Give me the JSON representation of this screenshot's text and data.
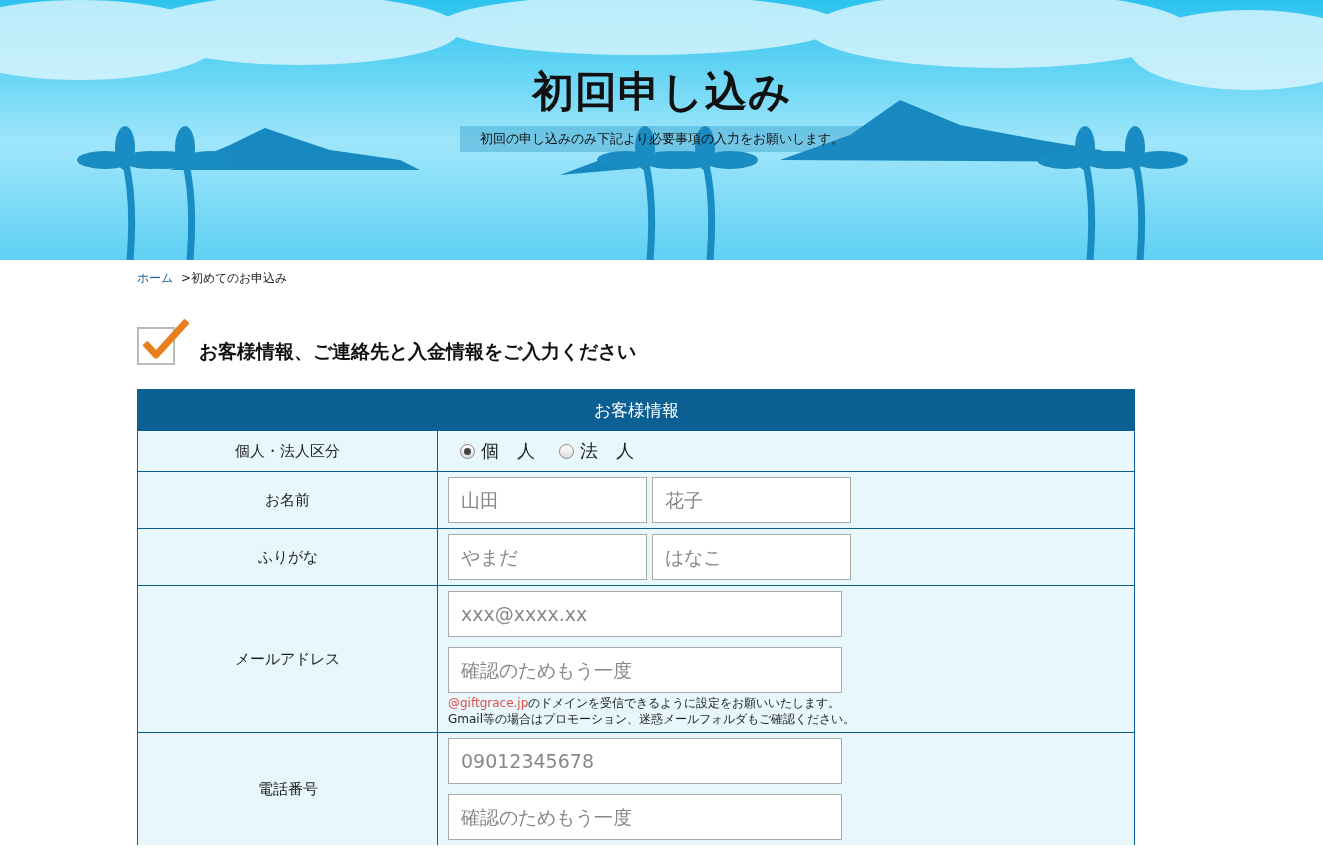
{
  "banner": {
    "title": "初回申し込み",
    "subtitle": "初回の申し込みのみ下記より必要事項の入力をお願いします。"
  },
  "breadcrumb": {
    "home": "ホーム",
    "current": ">初めてのお申込み"
  },
  "section": {
    "heading": "お客様情報、ご連絡先と入金情報をご入力ください",
    "checked": true
  },
  "form": {
    "title": "お客様情報",
    "rows": [
      {
        "kind": "radio",
        "label": "個人・法人区分",
        "options": [
          {
            "label": "個　人",
            "selected": true
          },
          {
            "label": "法　人",
            "selected": false
          }
        ]
      },
      {
        "kind": "pair",
        "label": "お名前",
        "fields": [
          {
            "placeholder": "山田"
          },
          {
            "placeholder": "花子"
          }
        ]
      },
      {
        "kind": "pair",
        "label": "ふりがな",
        "fields": [
          {
            "placeholder": "やまだ"
          },
          {
            "placeholder": "はなこ"
          }
        ]
      },
      {
        "kind": "stack",
        "label": "メールアドレス",
        "fields": [
          {
            "placeholder": "xxx@xxxx.xx"
          },
          {
            "placeholder": "確認のためもう一度"
          }
        ],
        "note": {
          "domain": "@giftgrace.jp",
          "line_1": "のドメインを受信できるように設定をお願いいたします。",
          "line_2": "Gmail等の場合はプロモーション、迷惑メールフォルダもご確認ください。"
        }
      },
      {
        "kind": "stack",
        "label": "電話番号",
        "fields": [
          {
            "placeholder": "09012345678"
          },
          {
            "placeholder": "確認のためもう一度"
          }
        ]
      }
    ]
  }
}
